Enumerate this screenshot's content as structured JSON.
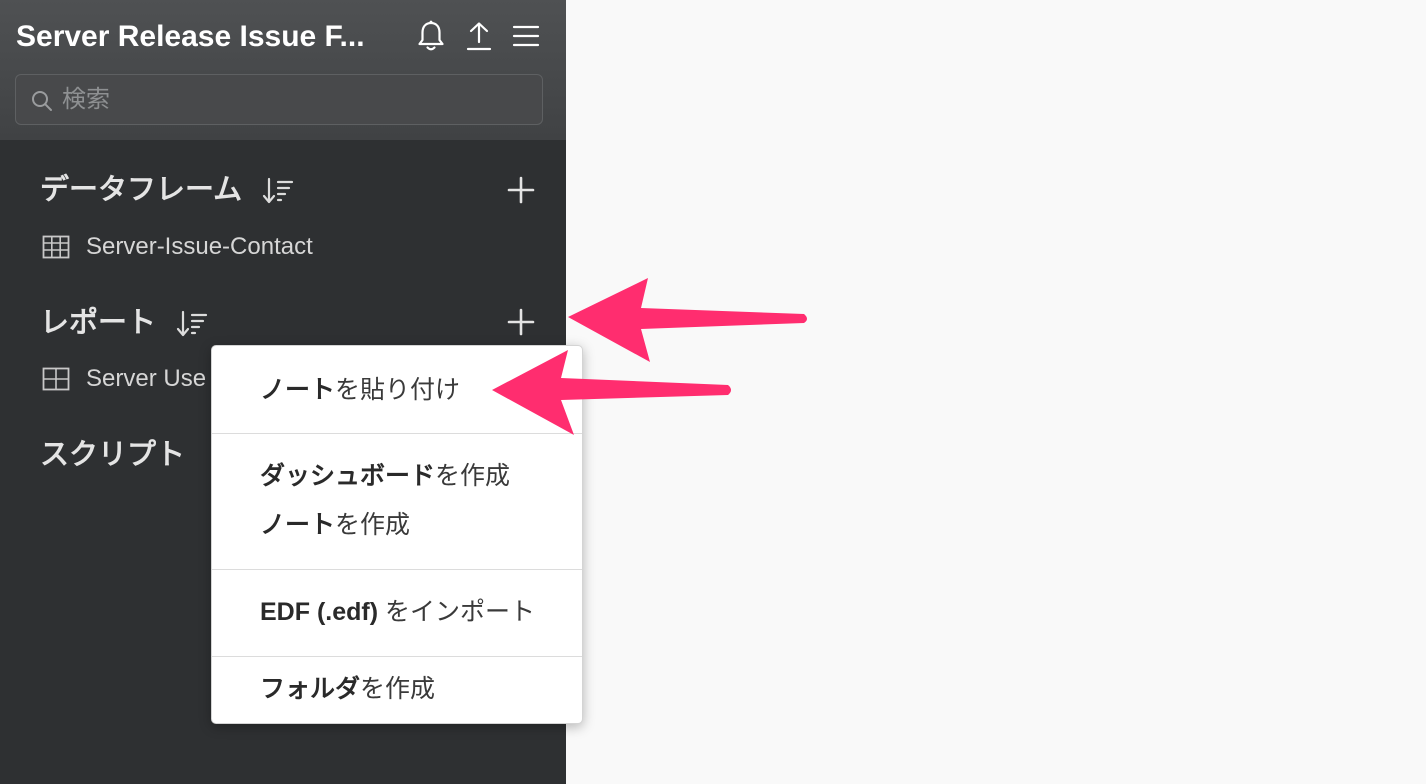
{
  "header": {
    "project_title": "Server Release Issue F...",
    "icons": [
      "bell-icon",
      "upload-icon",
      "hamburger-menu-icon"
    ]
  },
  "search": {
    "placeholder": "検索",
    "value": ""
  },
  "sections": {
    "dataframes": {
      "title": "データフレーム",
      "items": [
        {
          "icon": "table-grid-icon",
          "label": "Server-Issue-Contact"
        }
      ]
    },
    "reports": {
      "title": "レポート",
      "items": [
        {
          "icon": "report-grid-icon",
          "label": "Server Use"
        }
      ]
    },
    "scripts": {
      "title": "スクリプト"
    }
  },
  "add_menu": {
    "items": [
      {
        "bold": "ノート",
        "rest": "を貼り付け"
      },
      {
        "bold": "ダッシュボード",
        "rest": "を作成"
      },
      {
        "bold": "ノート",
        "rest": "を作成"
      },
      {
        "bold": "EDF (.edf)",
        "rest": " をインポート"
      },
      {
        "bold": "フォルダ",
        "rest": "を作成"
      }
    ]
  },
  "annotations": {
    "arrow_color": "#ff2d6f"
  },
  "colors": {
    "sidebar_bg": "#2e3032",
    "header_bg": "#48494b",
    "content_bg": "#f9f9f9",
    "menu_bg": "#ffffff"
  }
}
